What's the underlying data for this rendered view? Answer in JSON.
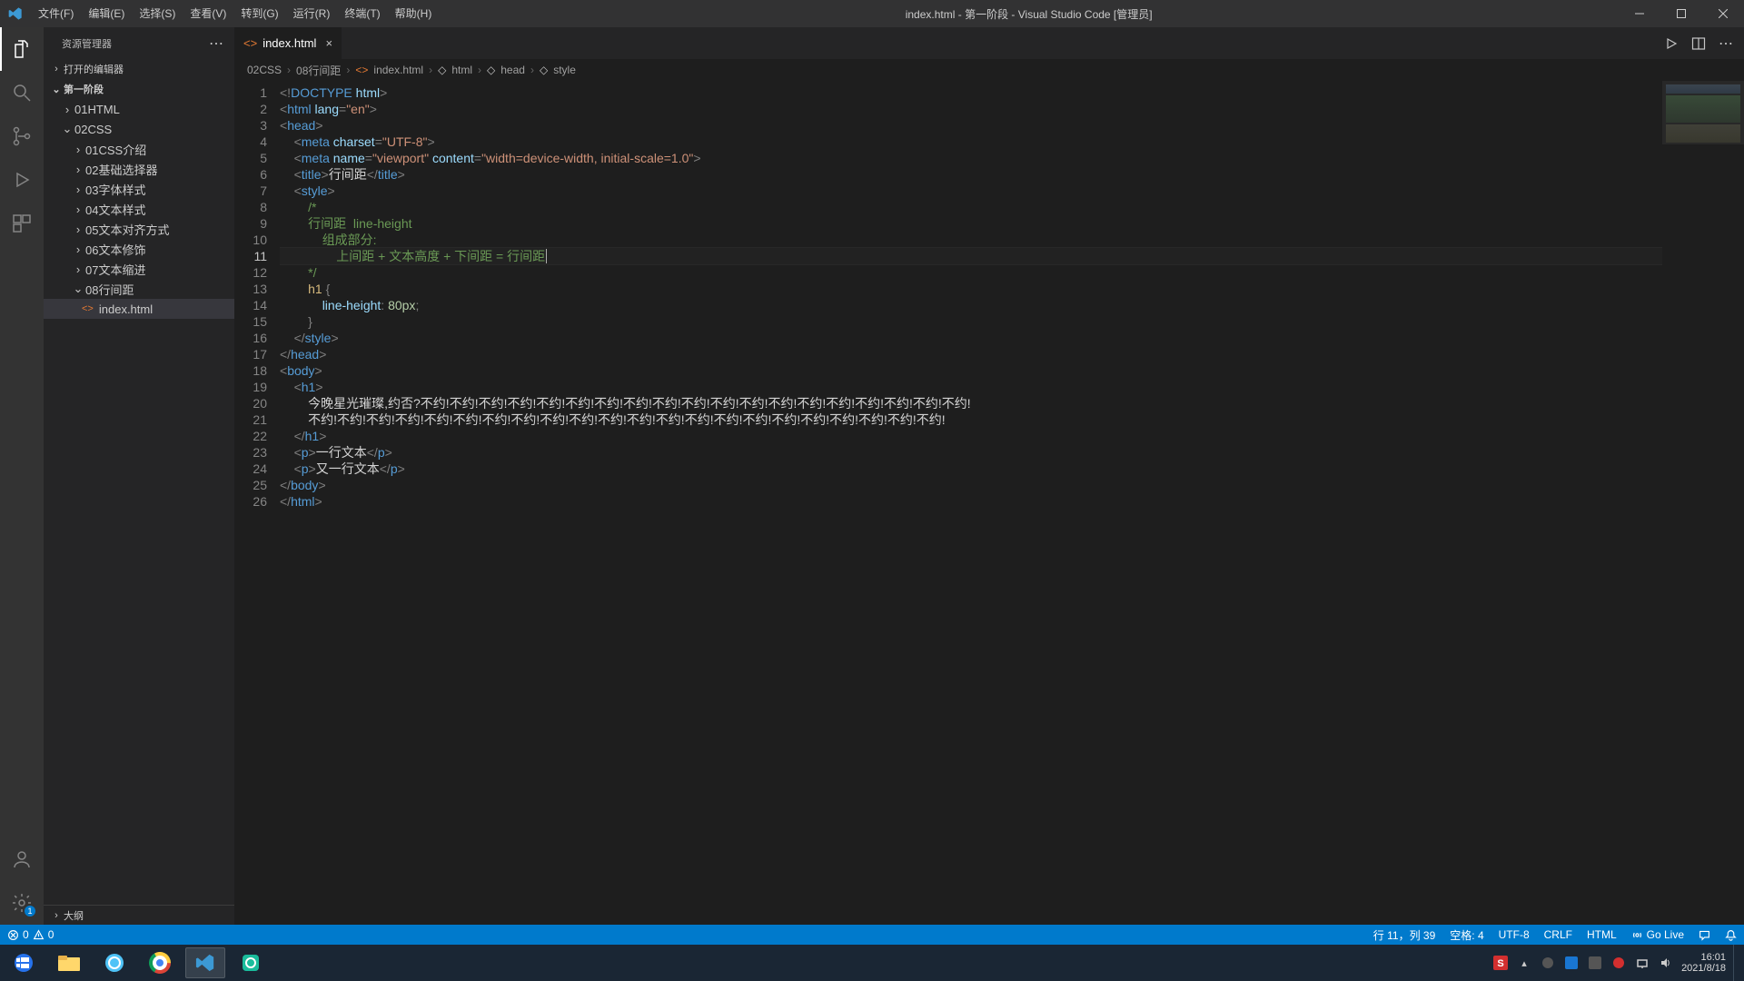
{
  "titlebar": {
    "menu": [
      "文件(F)",
      "编辑(E)",
      "选择(S)",
      "查看(V)",
      "转到(G)",
      "运行(R)",
      "终端(T)",
      "帮助(H)"
    ],
    "title": "index.html - 第一阶段 - Visual Studio Code [管理员]"
  },
  "activity": {
    "settings_badge": "1"
  },
  "sidebar": {
    "title": "资源管理器",
    "sections": {
      "open_editors": "打开的编辑器",
      "root": "第一阶段",
      "outline": "大纲"
    },
    "tree": {
      "folders1": [
        "01HTML"
      ],
      "folder_css": "02CSS",
      "css_children_closed": [
        "01CSS介绍",
        "02基础选择器",
        "03字体样式",
        "04文本样式",
        "05文本对齐方式",
        "06文本修饰",
        "07文本缩进"
      ],
      "css_child_open": "08行间距",
      "file": "index.html"
    }
  },
  "tab": {
    "label": "index.html"
  },
  "tab_actions": {
    "run": "run",
    "split": "split",
    "more": "more"
  },
  "breadcrumbs": {
    "parts": [
      "02CSS",
      "08行间距",
      "index.html",
      "html",
      "head",
      "style"
    ]
  },
  "code": {
    "lines": [
      {
        "n": 1,
        "html": "<span class='tk-punc'>&lt;!</span><span class='tk-doctype'>DOCTYPE</span> <span class='tk-attr'>html</span><span class='tk-punc'>&gt;</span>"
      },
      {
        "n": 2,
        "html": "<span class='tk-punc'>&lt;</span><span class='tk-tag'>html</span> <span class='tk-attr'>lang</span><span class='tk-punc'>=</span><span class='tk-str'>\"en\"</span><span class='tk-punc'>&gt;</span>"
      },
      {
        "n": 3,
        "html": "<span class='tk-punc'>&lt;</span><span class='tk-tag'>head</span><span class='tk-punc'>&gt;</span>"
      },
      {
        "n": 4,
        "html": "    <span class='tk-punc'>&lt;</span><span class='tk-tag'>meta</span> <span class='tk-attr'>charset</span><span class='tk-punc'>=</span><span class='tk-str'>\"UTF-8\"</span><span class='tk-punc'>&gt;</span>"
      },
      {
        "n": 5,
        "html": "    <span class='tk-punc'>&lt;</span><span class='tk-tag'>meta</span> <span class='tk-attr'>name</span><span class='tk-punc'>=</span><span class='tk-str'>\"viewport\"</span> <span class='tk-attr'>content</span><span class='tk-punc'>=</span><span class='tk-str'>\"width=device-width, initial-scale=1.0\"</span><span class='tk-punc'>&gt;</span>"
      },
      {
        "n": 6,
        "html": "    <span class='tk-punc'>&lt;</span><span class='tk-tag'>title</span><span class='tk-punc'>&gt;</span><span class='tk-text'>行间距</span><span class='tk-punc'>&lt;/</span><span class='tk-tag'>title</span><span class='tk-punc'>&gt;</span>"
      },
      {
        "n": 7,
        "html": "    <span class='tk-punc'>&lt;</span><span class='tk-tag'>style</span><span class='tk-punc'>&gt;</span>"
      },
      {
        "n": 8,
        "html": "        <span class='tk-comment'>/* </span>"
      },
      {
        "n": 9,
        "html": "        <span class='tk-comment'>行间距  line-height</span>"
      },
      {
        "n": 10,
        "html": "            <span class='tk-comment'>组成部分:</span>"
      },
      {
        "n": 11,
        "cur": true,
        "html": "                <span class='tk-comment'>上间距 + 文本高度 + 下间距 = 行间距</span><span class='cursor'></span>"
      },
      {
        "n": 12,
        "html": "        <span class='tk-comment'>*/</span>"
      },
      {
        "n": 13,
        "html": "        <span class='tk-sel'>h1</span> <span class='tk-punc'>{</span>"
      },
      {
        "n": 14,
        "html": "            <span class='tk-prop'>line-height</span><span class='tk-punc'>:</span> <span class='tk-num'>80px</span><span class='tk-punc'>;</span>"
      },
      {
        "n": 15,
        "html": "        <span class='tk-punc'>}</span>"
      },
      {
        "n": 16,
        "html": "    <span class='tk-punc'>&lt;/</span><span class='tk-tag'>style</span><span class='tk-punc'>&gt;</span>"
      },
      {
        "n": 17,
        "html": "<span class='tk-punc'>&lt;/</span><span class='tk-tag'>head</span><span class='tk-punc'>&gt;</span>"
      },
      {
        "n": 18,
        "html": "<span class='tk-punc'>&lt;</span><span class='tk-tag'>body</span><span class='tk-punc'>&gt;</span>"
      },
      {
        "n": 19,
        "html": "    <span class='tk-punc'>&lt;</span><span class='tk-tag'>h1</span><span class='tk-punc'>&gt;</span>"
      },
      {
        "n": 20,
        "html": "        <span class='tk-text'>今晚星光璀璨,约否?不约!不约!不约!不约!不约!不约!不约!不约!不约!不约!不约!不约!不约!不约!不约!不约!不约!不约!不约!</span>"
      },
      {
        "n": 21,
        "html": "        <span class='tk-text'>不约!不约!不约!不约!不约!不约!不约!不约!不约!不约!不约!不约!不约!不约!不约!不约!不约!不约!不约!不约!不约!不约!</span>"
      },
      {
        "n": 22,
        "html": "    <span class='tk-punc'>&lt;/</span><span class='tk-tag'>h1</span><span class='tk-punc'>&gt;</span>"
      },
      {
        "n": 23,
        "html": "    <span class='tk-punc'>&lt;</span><span class='tk-tag'>p</span><span class='tk-punc'>&gt;</span><span class='tk-text'>一行文本</span><span class='tk-punc'>&lt;/</span><span class='tk-tag'>p</span><span class='tk-punc'>&gt;</span>"
      },
      {
        "n": 24,
        "html": "    <span class='tk-punc'>&lt;</span><span class='tk-tag'>p</span><span class='tk-punc'>&gt;</span><span class='tk-text'>又一行文本</span><span class='tk-punc'>&lt;/</span><span class='tk-tag'>p</span><span class='tk-punc'>&gt;</span>"
      },
      {
        "n": 25,
        "html": "<span class='tk-punc'>&lt;/</span><span class='tk-tag'>body</span><span class='tk-punc'>&gt;</span>"
      },
      {
        "n": 26,
        "html": "<span class='tk-punc'>&lt;/</span><span class='tk-tag'>html</span><span class='tk-punc'>&gt;</span>"
      }
    ]
  },
  "status": {
    "errors": "0",
    "warnings": "0",
    "cursor": "行 11，列 39",
    "spaces": "空格: 4",
    "encoding": "UTF-8",
    "eol": "CRLF",
    "lang": "HTML",
    "golive": "Go Live"
  },
  "taskbar": {
    "time": "16:01",
    "date": "2021/8/18"
  }
}
